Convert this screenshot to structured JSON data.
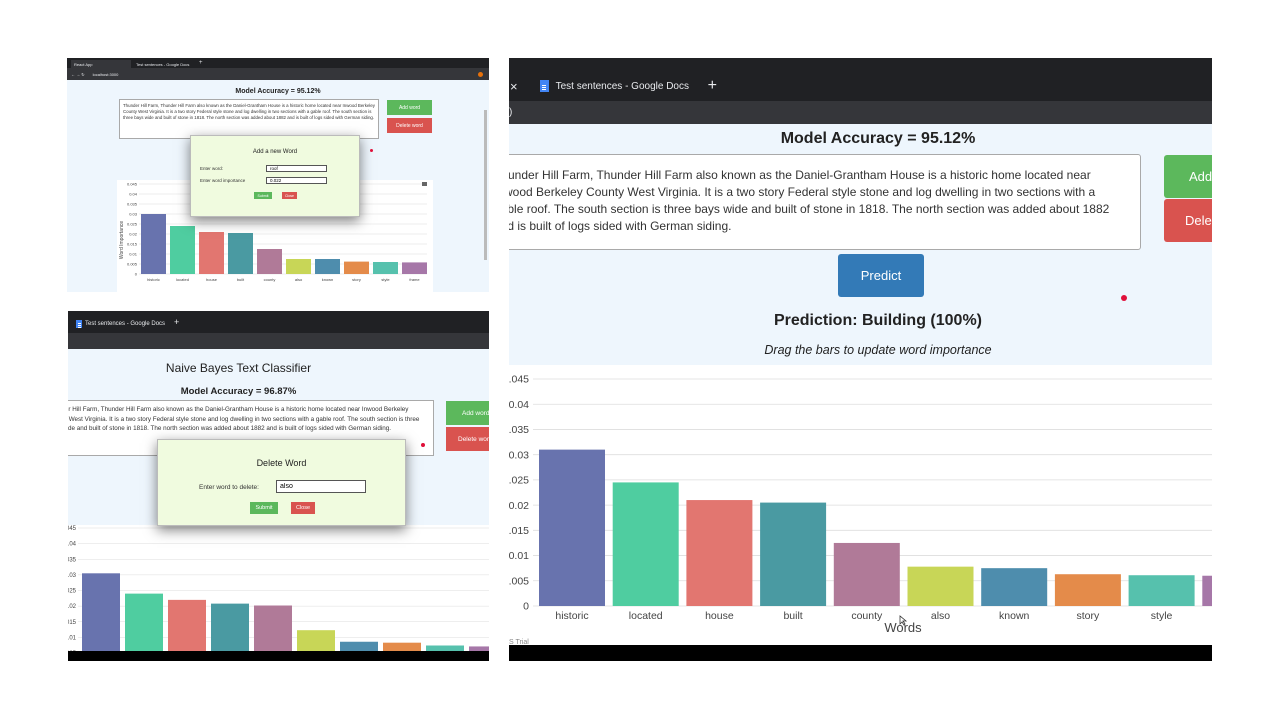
{
  "colors": [
    "#6873ae",
    "#4fcda0",
    "#e27670",
    "#4a9aa2",
    "#b07a98",
    "#c8d657",
    "#4e8dad",
    "#e48b4a",
    "#56c1ad",
    "#a677a8"
  ],
  "words": [
    "historic",
    "located",
    "house",
    "built",
    "county",
    "also",
    "known",
    "story",
    "style",
    "frame"
  ],
  "importance": [
    0.031,
    0.0245,
    0.021,
    0.0205,
    0.0125,
    0.0078,
    0.0075,
    0.0063,
    0.0061,
    0.006
  ],
  "app": {
    "title": "Naive Bayes Text Classifier",
    "sentence": "Thunder Hill Farm, Thunder Hill Farm also known as the Daniel-Grantham House is a historic home located near Inwood Berkeley County West Virginia. It is a two story Federal style stone and log dwelling in two sections with a gable roof. The south section is three bays wide and built of stone in 1818. The north section was added about 1882 and is built of logs sided with German siding.",
    "add_word": "Add word",
    "delete_word": "Delete word",
    "predict": "Predict",
    "prediction": "Prediction: Building (100%)",
    "drag_hint": "Drag the bars to update word importance"
  },
  "panel1": {
    "tab1": "React App",
    "tab2": "Test sentences - Google Docs",
    "url": "localhost:3000",
    "accuracy": "Model Accuracy = 95.12%",
    "modal_title": "Add a new Word",
    "label_word": "Enter word:",
    "label_importance": "Enter word importance",
    "value_word": "roof",
    "value_importance": "0.022",
    "submit": "Submit",
    "close": "Close",
    "ylabel": "Word Importance",
    "yticks": [
      "0.045",
      "0.04",
      "0.035",
      "0.03",
      "0.025",
      "0.02",
      "0.015",
      "0.01",
      "0.005",
      "0"
    ],
    "xticks": [
      "historic",
      "located",
      "house",
      "built",
      "county",
      "also",
      "known",
      "story",
      "style",
      "frame"
    ]
  },
  "panel2": {
    "tab": "Test sentences - Google Docs",
    "accuracy": "Model Accuracy = 96.87%",
    "modal_title": "Delete Word",
    "label": "Enter word to delete:",
    "value": "also",
    "submit": "Submit",
    "close": "Close",
    "yticks": [
      ".045",
      ".04",
      ".035",
      ".03",
      ".025",
      ".02",
      ".015",
      ".01",
      ".005"
    ]
  },
  "panel3": {
    "tab": "Test sentences - Google Docs",
    "accuracy": "Model Accuracy = 95.12%",
    "add_short": "Add",
    "delete_short": "Dele",
    "xlabel": "Words",
    "trial": "S Trial",
    "yticks": [
      ".045",
      "0.04",
      ".035",
      "0.03",
      ".025",
      "0.02",
      ".015",
      "0.01",
      ".005",
      "0"
    ]
  },
  "chart_data": [
    {
      "type": "bar",
      "ylabel": "Word Importance",
      "xlabel": "Words",
      "ylim": [
        0,
        0.045
      ],
      "categories": [
        "historic",
        "located",
        "house",
        "built",
        "county",
        "also",
        "known",
        "story",
        "style",
        "frame"
      ],
      "values": [
        0.03,
        0.024,
        0.021,
        0.0205,
        0.0125,
        0.0075,
        0.0075,
        0.0062,
        0.006,
        0.0058
      ]
    },
    {
      "type": "bar",
      "ylim": [
        0.005,
        0.045
      ],
      "values": [
        0.0305,
        0.024,
        0.022,
        0.0208,
        0.0202,
        0.0123,
        0.0086,
        0.0083,
        0.0074,
        0.0071
      ]
    },
    {
      "type": "bar",
      "xlabel": "Words",
      "ylim": [
        0,
        0.045
      ],
      "categories": [
        "historic",
        "located",
        "house",
        "built",
        "county",
        "also",
        "known",
        "story",
        "style"
      ],
      "values": [
        0.031,
        0.0245,
        0.021,
        0.0205,
        0.0125,
        0.0078,
        0.0075,
        0.0063,
        0.0061,
        0.006
      ]
    }
  ]
}
